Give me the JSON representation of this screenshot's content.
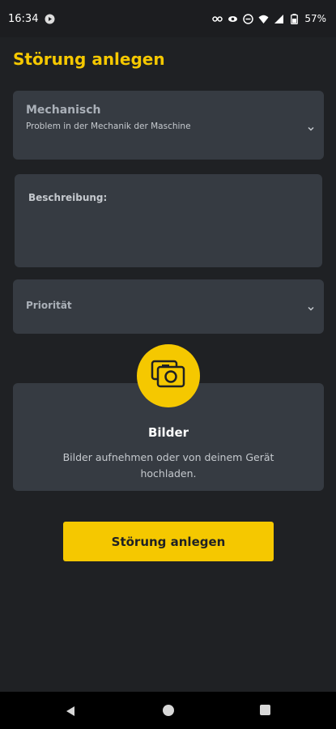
{
  "status_bar": {
    "time": "16:34",
    "battery_percent": "57%",
    "icons": [
      "media-icon",
      "link-icon",
      "eye-icon",
      "do-not-disturb-icon",
      "wifi-icon",
      "signal-icon",
      "battery-icon"
    ]
  },
  "page": {
    "title": "Störung anlegen"
  },
  "category_dropdown": {
    "value": "Mechanisch",
    "description": "Problem in der Mechanik der Maschine"
  },
  "description_field": {
    "placeholder": "Beschreibung:"
  },
  "priority_dropdown": {
    "placeholder": "Priorität"
  },
  "images": {
    "title": "Bilder",
    "description": "Bilder aufnehmen oder von deinem Gerät hochladen."
  },
  "submit": {
    "label": "Störung anlegen"
  },
  "colors": {
    "accent": "#f5c800",
    "background": "#1f2124",
    "card": "#363b42"
  }
}
